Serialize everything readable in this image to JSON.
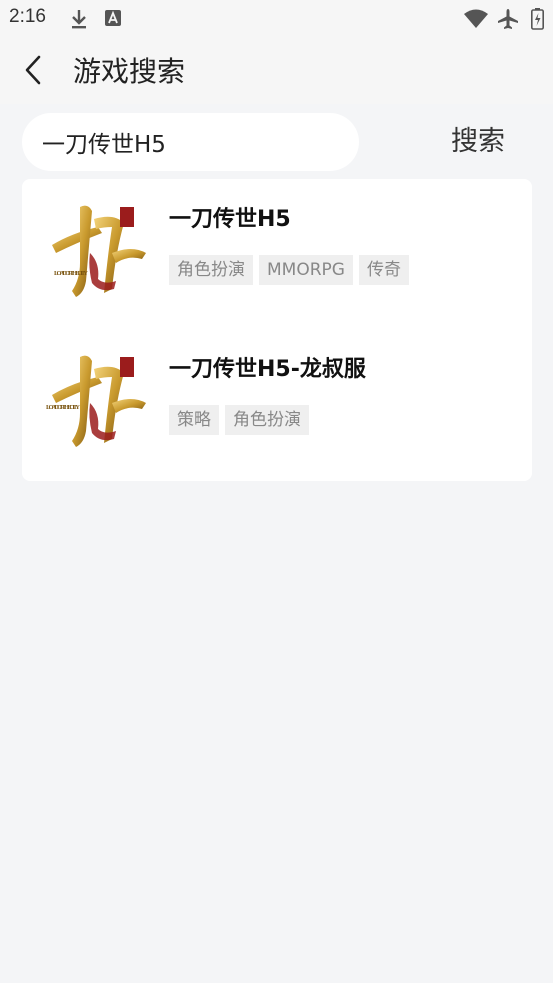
{
  "status_bar": {
    "time": "2:16",
    "icons": [
      "download-icon",
      "app-notification-icon",
      "wifi-icon",
      "airplane-icon",
      "battery-icon"
    ]
  },
  "header": {
    "back_icon": "chevron-left-icon",
    "title": "游戏搜索"
  },
  "search": {
    "value": "一刀传世H5",
    "button_label": "搜索"
  },
  "results": [
    {
      "name": "一刀传世H5",
      "logo_text": "LOAD OF THE CITY",
      "tags": [
        "角色扮演",
        "MMORPG",
        "传奇"
      ]
    },
    {
      "name": "一刀传世H5-龙叔服",
      "logo_text": "LOAD OF THE CITY",
      "tags": [
        "策略",
        "角色扮演"
      ]
    }
  ],
  "colors": {
    "background": "#f4f5f7",
    "card": "#ffffff",
    "tag_bg": "#efefef",
    "tag_text": "#888888",
    "logo_gold": "#c99a2e",
    "logo_red": "#9b1c1c"
  }
}
